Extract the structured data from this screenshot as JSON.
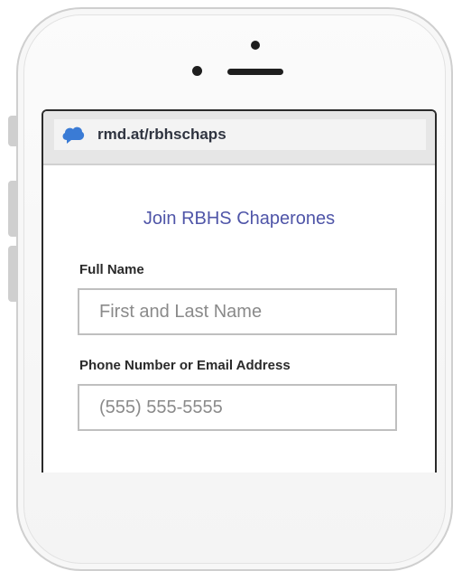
{
  "browser": {
    "url": "rmd.at/rbhschaps",
    "favicon": "cloud-icon"
  },
  "form": {
    "title": "Join RBHS Chaperones",
    "fields": [
      {
        "label": "Full Name",
        "placeholder": "First and Last Name",
        "value": ""
      },
      {
        "label": "Phone Number or Email Address",
        "placeholder": "(555) 555-5555",
        "value": ""
      }
    ]
  },
  "colors": {
    "title": "#4f55a8",
    "brand_cloud": "#3a7bd5"
  }
}
